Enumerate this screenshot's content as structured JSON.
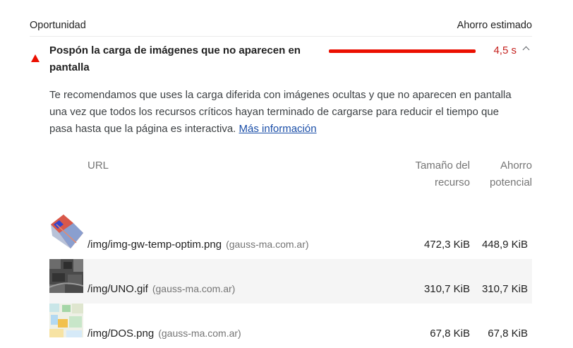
{
  "header": {
    "left": "Oportunidad",
    "right": "Ahorro estimado"
  },
  "audit": {
    "title": "Pospón la carga de imágenes que no aparecen en pantalla",
    "saving": "4,5 s",
    "bar_color": "#eb0f00",
    "description": "Te recomendamos que uses la carga diferida con imágenes ocultas y que no aparecen en pantalla una vez que todos los recursos críticos hayan terminado de cargarse para reducir el tiempo que pasa hasta que la página es interactiva.",
    "link": "Más información"
  },
  "table": {
    "col_url": "URL",
    "col_size": "Tamaño del recurso",
    "col_saving": "Ahorro potencial",
    "rows": [
      {
        "url": "/img/img-gw-temp-optim.png",
        "domain": "(gauss-ma.com.ar)",
        "size": "472,3 KiB",
        "saving": "448,9 KiB"
      },
      {
        "url": "/img/UNO.gif",
        "domain": "(gauss-ma.com.ar)",
        "size": "310,7 KiB",
        "saving": "310,7 KiB"
      },
      {
        "url": "/img/DOS.png",
        "domain": "(gauss-ma.com.ar)",
        "size": "67,8 KiB",
        "saving": "67,8 KiB"
      }
    ]
  }
}
